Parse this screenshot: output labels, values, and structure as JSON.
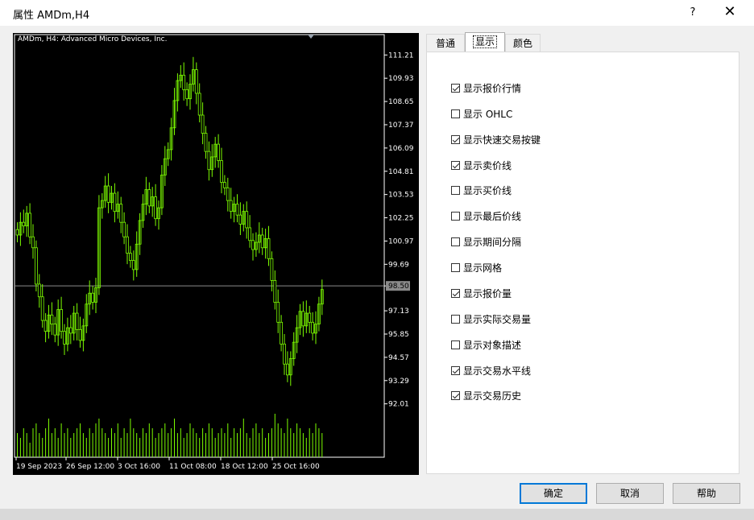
{
  "window": {
    "title": "属性 AMDm,H4",
    "help_label": "?",
    "close_label": "✕",
    "close_icon": "close-icon"
  },
  "chart": {
    "label": "AMDm, H4:  Advanced Micro Devices, Inc.",
    "current_price": "98.50",
    "colors": {
      "candle": "#7CFC00",
      "grid": "#ffffff",
      "price_line": "#8a8a8a",
      "background": "#000000"
    }
  },
  "tabs": [
    {
      "label": "普通",
      "active": false
    },
    {
      "label": "显示",
      "active": true
    },
    {
      "label": "颜色",
      "active": false
    }
  ],
  "options": [
    {
      "label": "显示报价行情",
      "checked": true
    },
    {
      "label": "显示 OHLC",
      "checked": false
    },
    {
      "label": "显示快速交易按键",
      "checked": true
    },
    {
      "label": "显示卖价线",
      "checked": true
    },
    {
      "label": "显示买价线",
      "checked": false
    },
    {
      "label": "显示最后价线",
      "checked": false
    },
    {
      "label": "显示期间分隔",
      "checked": false
    },
    {
      "label": "显示网格",
      "checked": false
    },
    {
      "label": "显示报价量",
      "checked": true
    },
    {
      "label": "显示实际交易量",
      "checked": false
    },
    {
      "label": "显示对象描述",
      "checked": false
    },
    {
      "label": "显示交易水平线",
      "checked": true
    },
    {
      "label": "显示交易历史",
      "checked": true
    }
  ],
  "buttons": {
    "ok": "确定",
    "cancel": "取消",
    "help": "帮助"
  },
  "chart_data": {
    "type": "candlestick",
    "title": "AMDm, H4:  Advanced Micro Devices, Inc.",
    "x_tick_labels": [
      "19 Sep 2023",
      "26 Sep 12:00",
      "3 Oct 16:00",
      "11 Oct 08:00",
      "18 Oct 12:00",
      "25 Oct 16:00"
    ],
    "y_tick_labels": [
      "111.21",
      "109.93",
      "108.65",
      "107.37",
      "106.09",
      "104.81",
      "103.53",
      "102.25",
      "100.97",
      "99.69",
      "98.50",
      "97.13",
      "95.85",
      "94.57",
      "93.29",
      "92.01"
    ],
    "ylim": [
      92.01,
      111.21
    ],
    "current_price": 98.5,
    "close_series": [
      101.3,
      102.0,
      101.8,
      102.5,
      101.2,
      100.6,
      98.6,
      97.9,
      96.6,
      96.0,
      96.9,
      96.4,
      95.8,
      97.2,
      96.0,
      95.3,
      96.2,
      95.9,
      97.0,
      96.1,
      95.5,
      96.3,
      97.5,
      98.1,
      97.6,
      98.4,
      102.8,
      103.2,
      104.0,
      103.1,
      103.6,
      102.6,
      103.0,
      102.0,
      101.2,
      100.3,
      99.9,
      99.4,
      100.8,
      102.1,
      103.0,
      103.8,
      102.9,
      103.4,
      102.2,
      102.8,
      104.6,
      105.5,
      106.0,
      107.2,
      108.7,
      109.8,
      110.1,
      109.3,
      108.8,
      109.6,
      110.4,
      109.1,
      107.9,
      106.9,
      105.9,
      104.9,
      105.6,
      106.3,
      105.4,
      104.2,
      103.9,
      103.2,
      102.6,
      103.0,
      102.4,
      101.9,
      102.6,
      101.7,
      101.0,
      100.5,
      100.9,
      101.3,
      100.6,
      101.1,
      100.0,
      98.8,
      97.6,
      96.5,
      95.3,
      94.2,
      93.6,
      94.5,
      95.4,
      96.2,
      97.1,
      96.3,
      97.0,
      96.5,
      95.9,
      96.4,
      97.5,
      98.3
    ],
    "volume_series": [
      5,
      4,
      6,
      5,
      3,
      6,
      7,
      5,
      4,
      6,
      8,
      5,
      6,
      4,
      7,
      5,
      6,
      4,
      5,
      6,
      7,
      5,
      4,
      6,
      5,
      7,
      8,
      6,
      5,
      4,
      6,
      5,
      7,
      4,
      6,
      5,
      8,
      6,
      5,
      4,
      6,
      5,
      7,
      6,
      4,
      5,
      6,
      7,
      5,
      6,
      8,
      5,
      6,
      4,
      5,
      7,
      6,
      5,
      4,
      6,
      5,
      7,
      6,
      4,
      5,
      6,
      5,
      7,
      4,
      6,
      5,
      6,
      8,
      5,
      4,
      6,
      7,
      5,
      6,
      4,
      5,
      6,
      9,
      7,
      6,
      5,
      8,
      6,
      5,
      7,
      6,
      5,
      4,
      6,
      5,
      7,
      6,
      5
    ]
  }
}
